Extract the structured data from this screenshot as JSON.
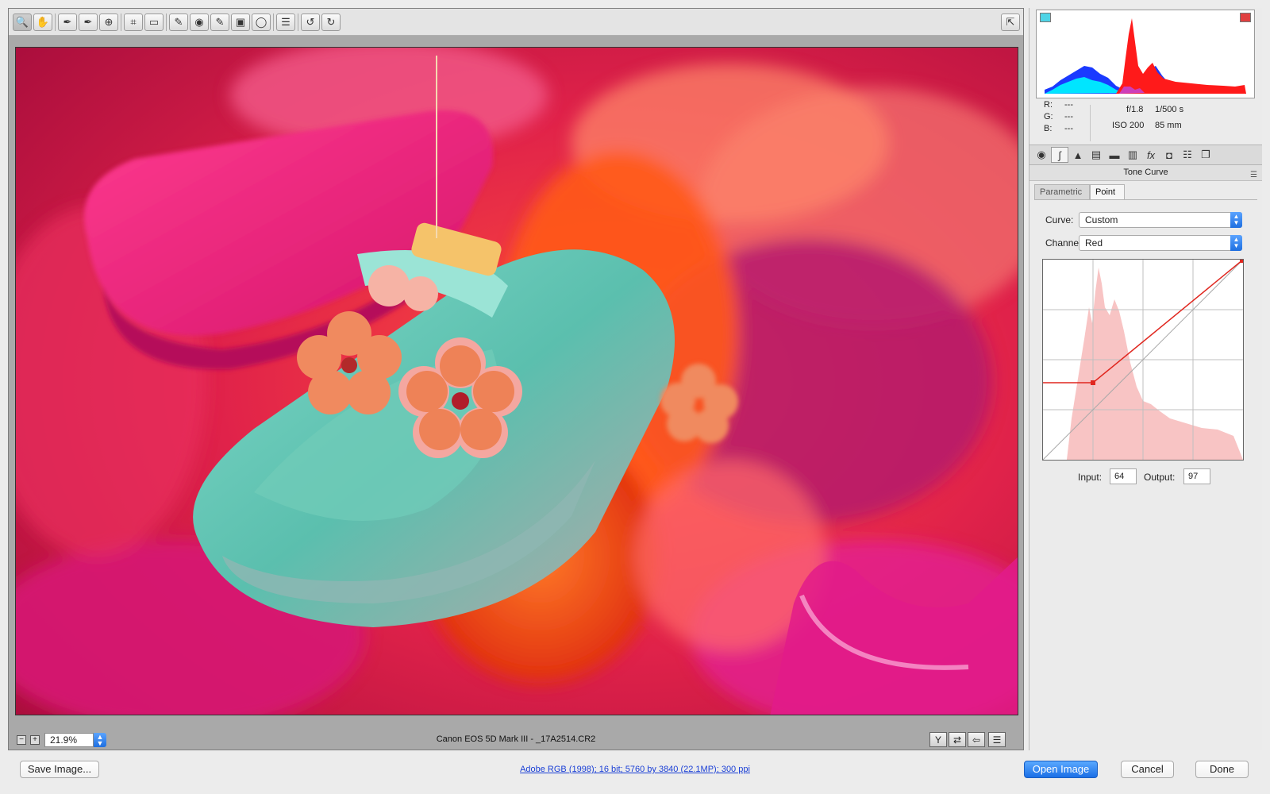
{
  "toolbar": {
    "tools": [
      {
        "name": "zoom-tool",
        "glyph": "🔍"
      },
      {
        "name": "hand-tool",
        "glyph": "✋"
      },
      {
        "name": "white-balance-tool",
        "glyph": "✒"
      },
      {
        "name": "color-sampler-tool",
        "glyph": "✒"
      },
      {
        "name": "targeted-adjustment-tool",
        "glyph": "⊕"
      },
      {
        "name": "crop-tool",
        "glyph": "⌗"
      },
      {
        "name": "straighten-tool",
        "glyph": "▭"
      },
      {
        "name": "spot-removal-tool",
        "glyph": "✎"
      },
      {
        "name": "red-eye-removal-tool",
        "glyph": "◉"
      },
      {
        "name": "adjustment-brush-tool",
        "glyph": "✎"
      },
      {
        "name": "graduated-filter-tool",
        "glyph": "▣"
      },
      {
        "name": "radial-filter-tool",
        "glyph": "◯"
      },
      {
        "name": "preferences-tool",
        "glyph": "☰"
      },
      {
        "name": "rotate-left-tool",
        "glyph": "↺"
      },
      {
        "name": "rotate-right-tool",
        "glyph": "↻"
      }
    ],
    "fullscreen_glyph": "⇱"
  },
  "status": {
    "zoom_value": "21.9%",
    "zoom_minus": "−",
    "zoom_plus": "+",
    "filename_text": "Canon EOS 5D Mark III  -  _17A2514.CR2",
    "icons": [
      {
        "name": "before-after-toggle",
        "glyph": "Y"
      },
      {
        "name": "swap-settings",
        "glyph": "⇄"
      },
      {
        "name": "copy-settings",
        "glyph": "⇦"
      },
      {
        "name": "view-settings",
        "glyph": "☰"
      }
    ]
  },
  "readout": {
    "r_label": "R:",
    "r_value": "---",
    "g_label": "G:",
    "g_value": "---",
    "b_label": "B:",
    "b_value": "---",
    "aperture": "f/1.8",
    "shutter": "1/500 s",
    "iso": "ISO 200",
    "focal": "85 mm"
  },
  "panel_tabs": [
    {
      "name": "basic",
      "glyph": "◉"
    },
    {
      "name": "tone-curve",
      "glyph": "∫"
    },
    {
      "name": "detail",
      "glyph": "▲"
    },
    {
      "name": "hsl",
      "glyph": "▤"
    },
    {
      "name": "split-toning",
      "glyph": "▬"
    },
    {
      "name": "lens-corrections",
      "glyph": "▥"
    },
    {
      "name": "effects",
      "glyph": "fx"
    },
    {
      "name": "camera-calibration",
      "glyph": "◘"
    },
    {
      "name": "presets",
      "glyph": "☷"
    },
    {
      "name": "snapshots",
      "glyph": "❐"
    }
  ],
  "panel": {
    "title": "Tone Curve",
    "menu_glyph": "☰",
    "subtab_parametric": "Parametric",
    "subtab_point": "Point",
    "curve_label": "Curve:",
    "curve_value": "Custom",
    "channel_label": "Channel:",
    "channel_value": "Red",
    "input_label": "Input:",
    "input_value": "64",
    "output_label": "Output:",
    "output_value": "97"
  },
  "bottom": {
    "save_label": "Save Image...",
    "workflow_text": "Adobe RGB (1998); 16 bit; 5760 by 3840 (22.1MP); 300 ppi",
    "open_label": "Open Image",
    "cancel_label": "Cancel",
    "done_label": "Done"
  },
  "colors": {
    "accent": "#1b6fe6",
    "curve_red": "#e0271f",
    "histogram_red": "#ff1a1a",
    "histogram_blue": "#1a3aff",
    "histogram_cyan": "#00e5ff"
  }
}
